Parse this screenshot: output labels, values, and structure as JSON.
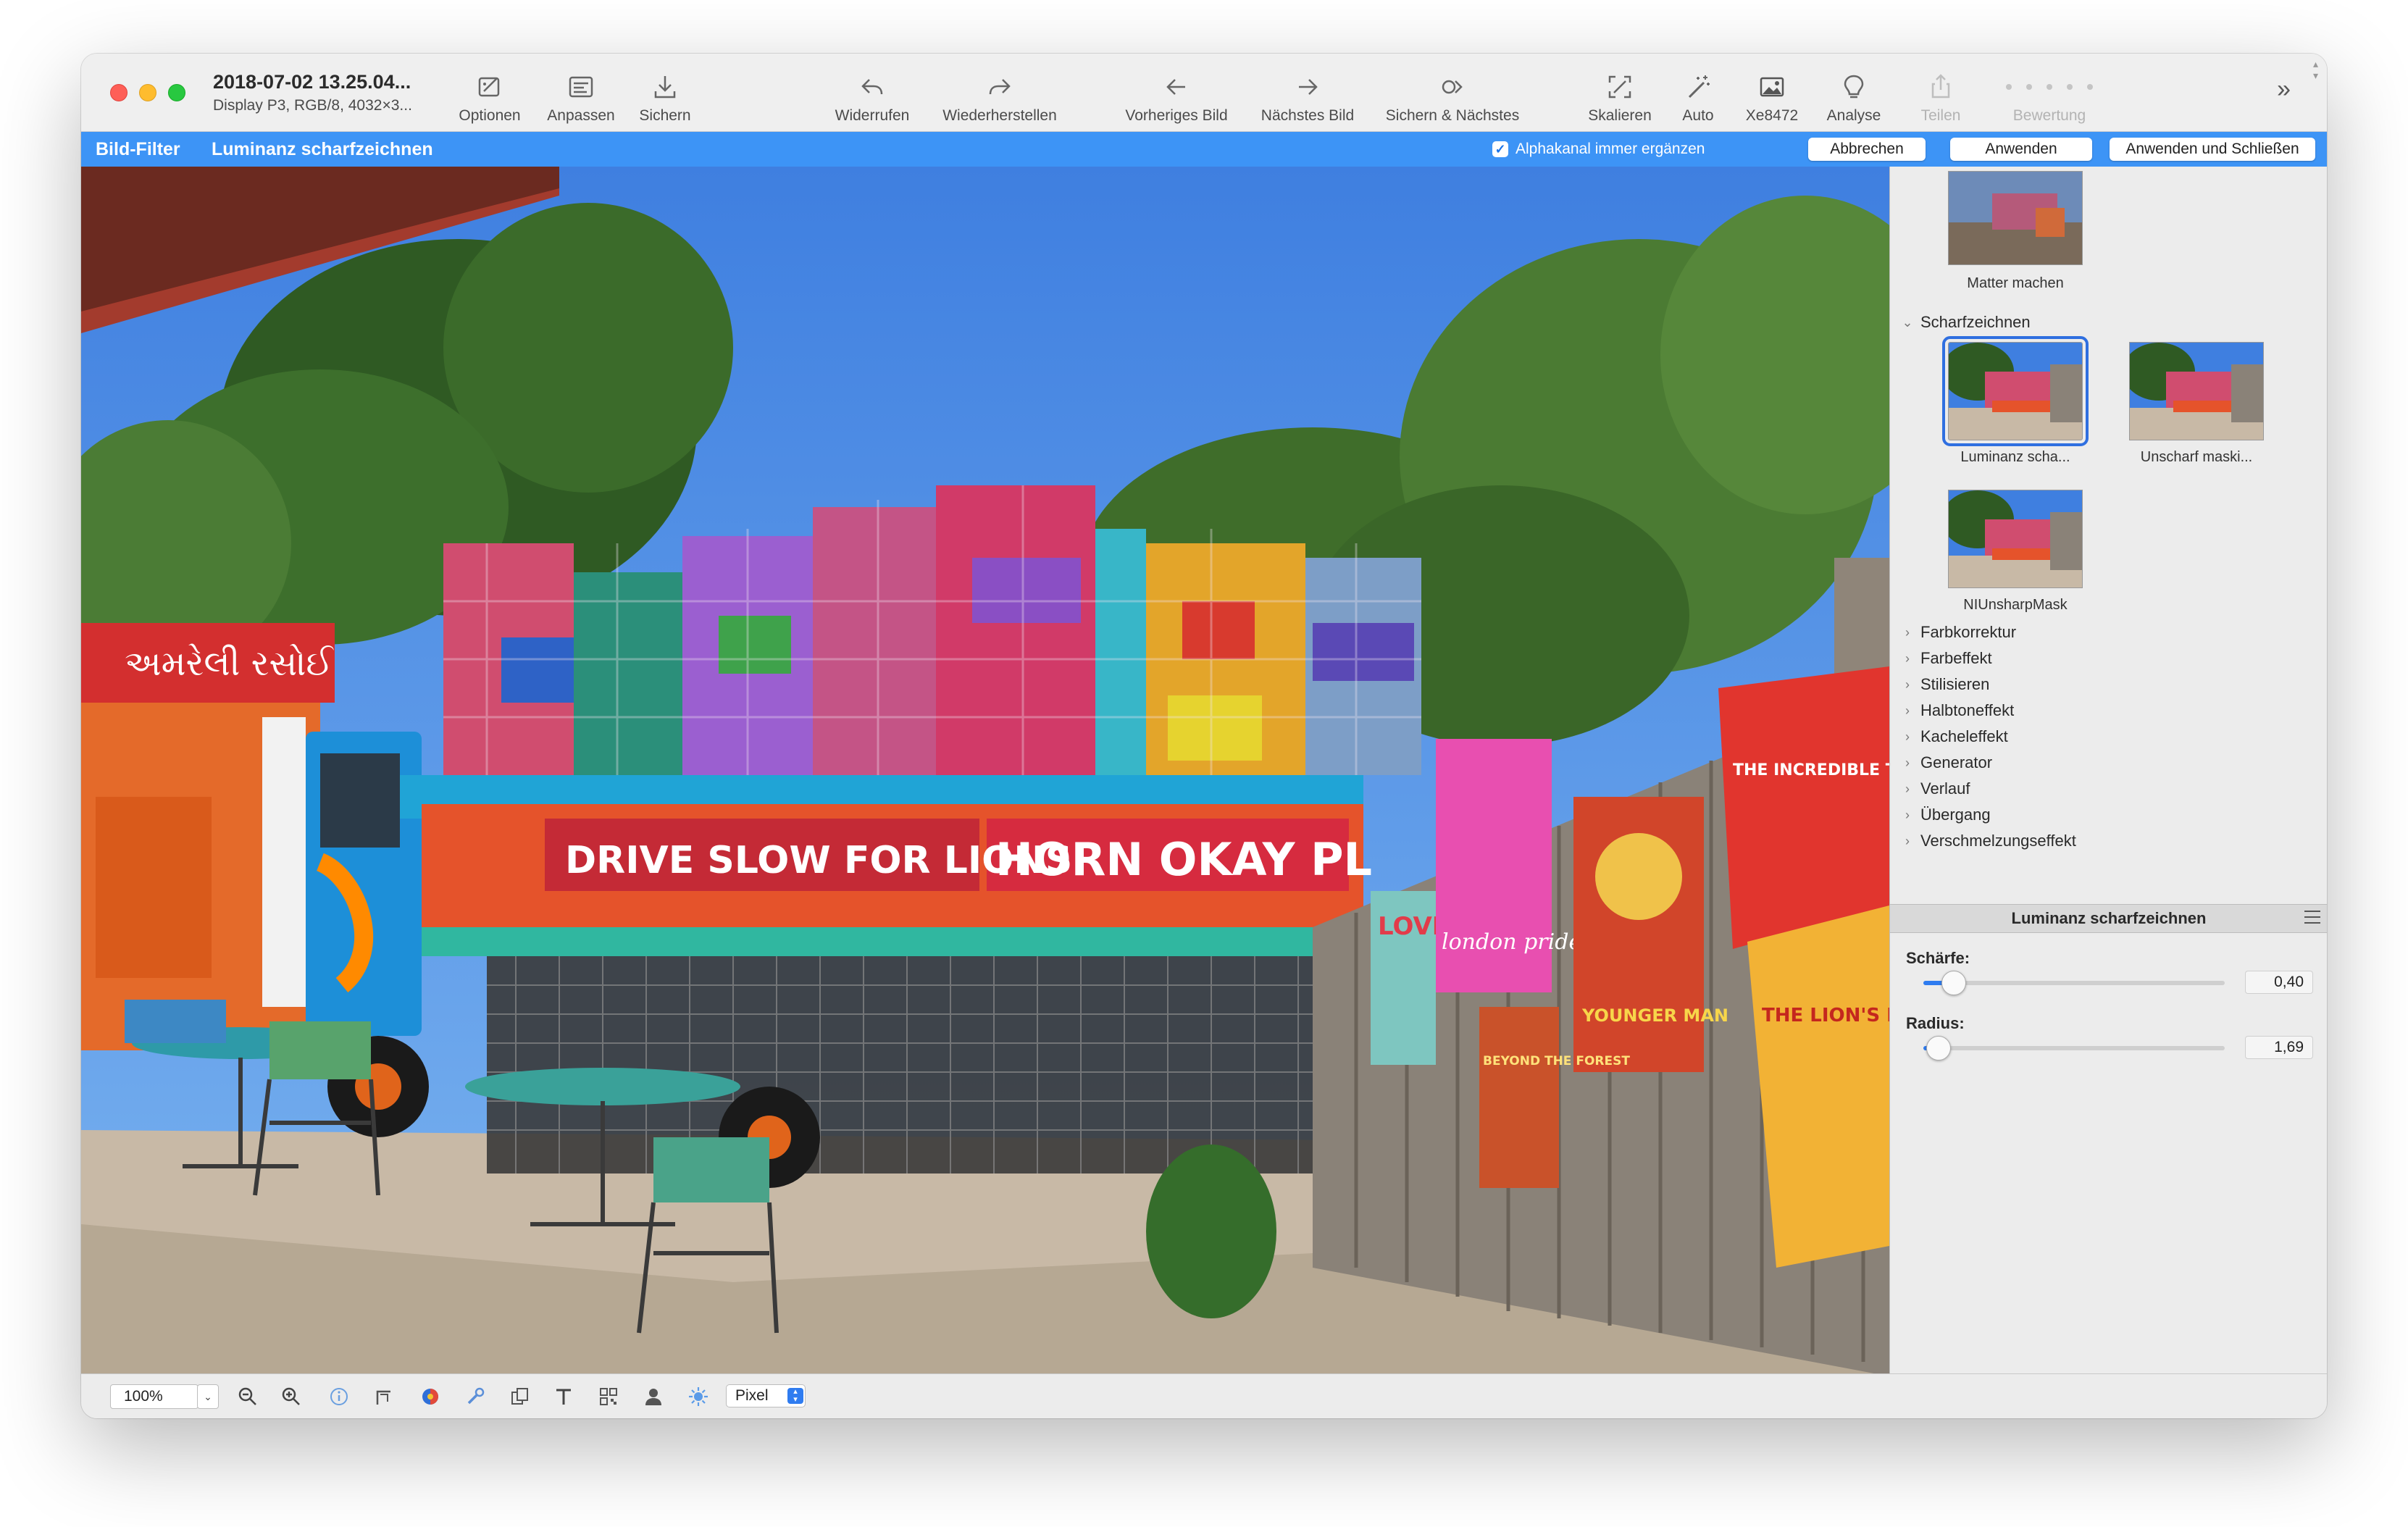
{
  "window": {
    "title": "2018-07-02 13.25.04...",
    "subtitle": "Display P3, RGB/8, 4032×3..."
  },
  "toolbar": {
    "items": [
      {
        "label": "Optionen",
        "icon": "options-icon"
      },
      {
        "label": "Anpassen",
        "icon": "adjust-icon"
      },
      {
        "label": "Sichern",
        "icon": "save-icon"
      },
      {
        "label": "Widerrufen",
        "icon": "undo-icon"
      },
      {
        "label": "Wiederherstellen",
        "icon": "redo-icon"
      },
      {
        "label": "Vorheriges Bild",
        "icon": "previous-image-icon"
      },
      {
        "label": "Nächstes Bild",
        "icon": "next-image-icon"
      },
      {
        "label": "Sichern & Nächstes",
        "icon": "save-next-icon"
      },
      {
        "label": "Skalieren",
        "icon": "scale-icon"
      },
      {
        "label": "Auto",
        "icon": "magic-wand-icon"
      },
      {
        "label": "Xe8472",
        "icon": "image-icon"
      },
      {
        "label": "Analyse",
        "icon": "lightbulb-icon"
      },
      {
        "label": "Teilen",
        "icon": "share-icon"
      },
      {
        "label": "Bewertung",
        "icon": "rating-icon"
      }
    ]
  },
  "filterbar": {
    "title": "Bild-Filter",
    "filter_name": "Luminanz scharfzeichnen",
    "alpha_checkbox_label": "Alphakanal immer ergänzen",
    "alpha_checked": true,
    "cancel": "Abbrechen",
    "apply": "Anwenden",
    "apply_close": "Anwenden und Schließen",
    "accent_color": "#3d94f6"
  },
  "photo": {
    "truck_signs": [
      "DRIVE SLOW FOR LIONS",
      "HORN OKAY PL"
    ],
    "booth_sign": "અમરેલી રસોઈ",
    "posters": [
      "LOVE",
      "london pride",
      "YOUNGER MAN",
      "BEYOND THE FOREST",
      "THE INCREDIBLE TAIL",
      "THE LION'S ROAR"
    ]
  },
  "panel": {
    "top_thumb_label": "Matter machen",
    "section_open": "Scharfzeichnen",
    "filters": [
      {
        "label": "Luminanz scha...",
        "selected": true
      },
      {
        "label": "Unscharf maski...",
        "selected": false
      },
      {
        "label": "NIUnsharpMask",
        "selected": false
      }
    ],
    "categories": [
      "Farbkorrektur",
      "Farbeffekt",
      "Stilisieren",
      "Halbtoneffekt",
      "Kacheleffekt",
      "Generator",
      "Verlauf",
      "Übergang",
      "Verschmelzungseffekt"
    ],
    "adjust_title": "Luminanz scharfzeichnen",
    "params": [
      {
        "label": "Schärfe:",
        "value": "0,40",
        "fraction": 0.1
      },
      {
        "label": "Radius:",
        "value": "1,69",
        "fraction": 0.05
      }
    ]
  },
  "statusbar": {
    "zoom": "100%",
    "unit": "Pixel",
    "icons": [
      "zoom-out-icon",
      "zoom-in-icon",
      "info-icon",
      "crop-icon",
      "color-icon",
      "tools-icon",
      "copy-icon",
      "text-icon",
      "qr-icon",
      "person-icon",
      "brightness-icon"
    ]
  }
}
